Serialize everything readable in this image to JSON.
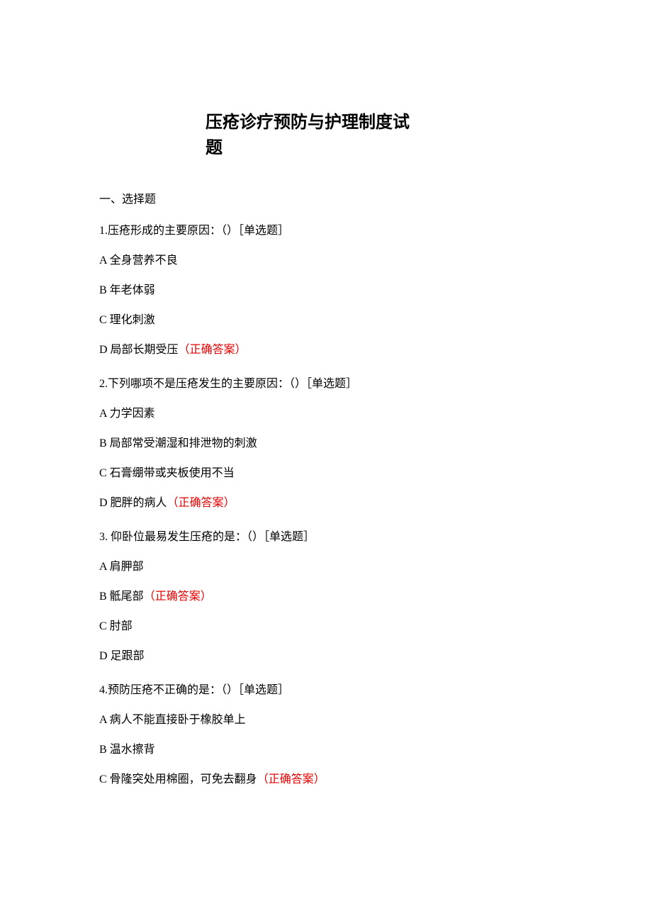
{
  "title": "压疮诊疗预防与护理制度试题",
  "section_heading": "一、选择题",
  "questions": [
    {
      "stem": "1.压疮形成的主要原因：（）［单选题］",
      "options": [
        {
          "text": "A 全身营养不良",
          "correct": false
        },
        {
          "text": "B 年老体弱",
          "correct": false
        },
        {
          "text": "C 理化刺激",
          "correct": false
        },
        {
          "text": "D 局部长期受压",
          "correct": true
        }
      ]
    },
    {
      "stem": "2.下列哪项不是压疮发生的主要原因：（）［单选题］",
      "options": [
        {
          "text": "A 力学因素",
          "correct": false
        },
        {
          "text": "B 局部常受潮湿和排泄物的刺激",
          "correct": false
        },
        {
          "text": "C 石膏绷带或夹板使用不当",
          "correct": false
        },
        {
          "text": "D 肥胖的病人",
          "correct": true
        }
      ]
    },
    {
      "stem": "3. 仰卧位最易发生压疮的是：（）［单选题］",
      "options": [
        {
          "text": "A 肩胛部",
          "correct": false
        },
        {
          "text": "B 骶尾部",
          "correct": true
        },
        {
          "text": "C 肘部",
          "correct": false
        },
        {
          "text": "D 足跟部",
          "correct": false
        }
      ]
    },
    {
      "stem": "4.预防压疮不正确的是：（）［单选题］",
      "options": [
        {
          "text": "A 病人不能直接卧于橡胶单上",
          "correct": false
        },
        {
          "text": "B 温水擦背",
          "correct": false
        },
        {
          "text": "C 骨隆突处用棉圈，可免去翻身",
          "correct": true
        }
      ]
    }
  ],
  "correct_label": "（正确答案）"
}
